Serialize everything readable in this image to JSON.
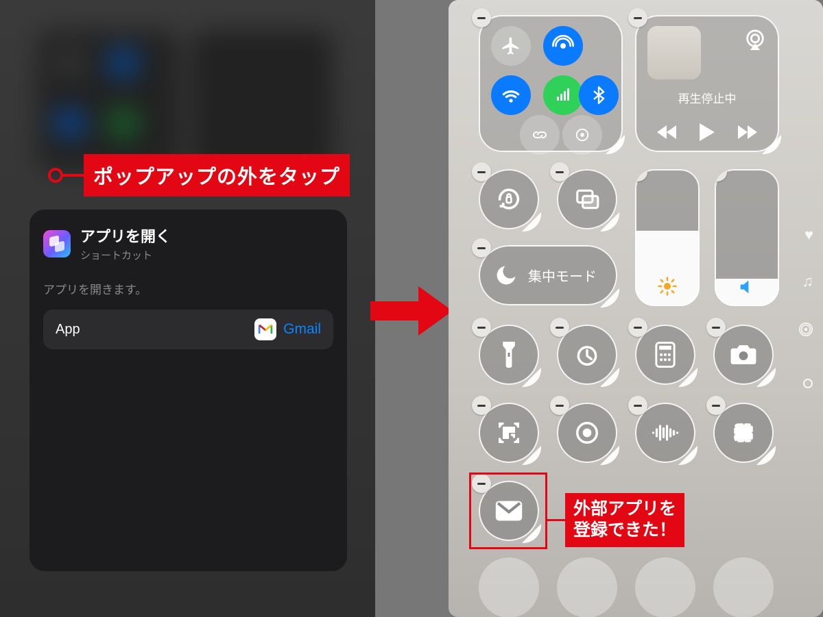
{
  "left": {
    "callout": "ポップアップの外をタップ",
    "popup": {
      "title": "アプリを開く",
      "subtitle": "ショートカット",
      "description": "アプリを開きます。",
      "row_label": "App",
      "selected_app": "Gmail"
    }
  },
  "right": {
    "media_status": "再生停止中",
    "focus_label": "集中モード",
    "callout_line1": "外部アプリを",
    "callout_line2": "登録できた！",
    "brightness_percent": 55,
    "volume_percent": 20
  },
  "icons": {
    "airplane": "airplane-icon",
    "airdrop": "airdrop-icon",
    "wifi": "wifi-icon",
    "cellular": "cellular-icon",
    "bluetooth": "bluetooth-icon",
    "link": "personal-hotspot-icon",
    "vpn": "vpn-icon",
    "airplay": "airplay-icon",
    "rewind": "rewind-icon",
    "play": "play-icon",
    "forward": "forward-icon",
    "rotation": "rotation-lock-icon",
    "mirroring": "screen-mirroring-icon",
    "moon": "focus-moon-icon",
    "sun": "brightness-sun-icon",
    "speaker": "volume-speaker-icon",
    "flashlight": "flashlight-icon",
    "timer": "timer-icon",
    "calculator": "calculator-icon",
    "camera": "camera-icon",
    "qr": "qr-scan-icon",
    "record": "screen-record-icon",
    "sound": "sound-recognition-icon",
    "crop": "crop-icon",
    "gmail": "gmail-icon",
    "heart": "favorites-heart-icon",
    "music": "favorites-music-icon",
    "broadcast": "favorites-broadcast-icon",
    "dot": "favorites-dot-icon"
  }
}
